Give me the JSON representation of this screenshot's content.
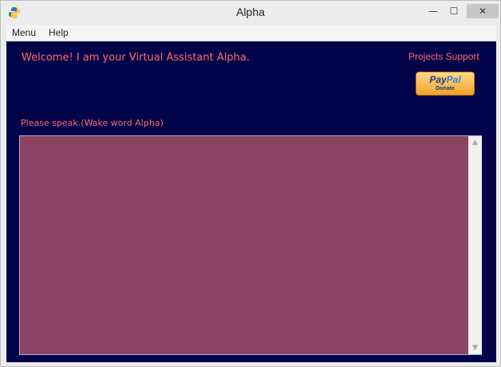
{
  "window": {
    "title": "Alpha",
    "minimize": "—",
    "maximize": "☐",
    "close": "✕"
  },
  "menubar": {
    "items": [
      "Menu",
      "Help"
    ]
  },
  "main": {
    "welcome": "Welcome! I am your Virtual Assistant Alpha.",
    "projects_support": "Projects Support",
    "paypal": {
      "logo_a": "Pay",
      "logo_b": "Pal",
      "donate": "Donate"
    },
    "prompt": "Please speak.(Wake word Alpha)",
    "output_text": ""
  },
  "scrollbar": {
    "up": "▲",
    "down": "▼"
  },
  "colors": {
    "background": "#020349",
    "text_accent": "#ff6a6a",
    "textarea": "#8c4465"
  }
}
